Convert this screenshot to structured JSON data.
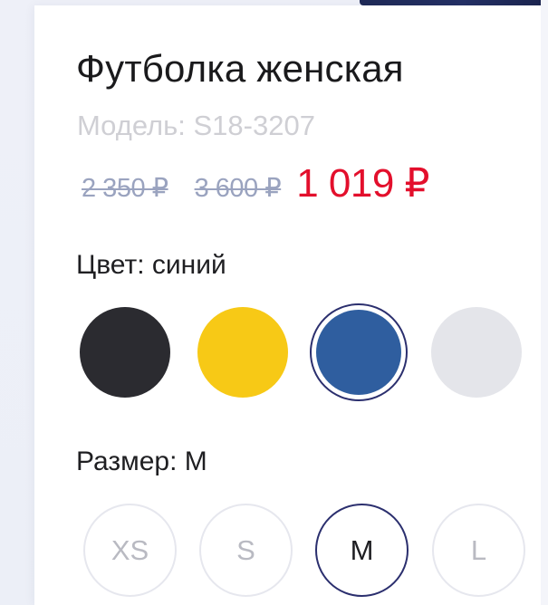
{
  "product": {
    "title": "Футболка женская",
    "model": "Модель: S18-3207"
  },
  "prices": {
    "old_1": "2 350 ₽",
    "old_2": "3 600 ₽",
    "current": "1 019 ₽"
  },
  "color_picker": {
    "label": "Цвет: синий",
    "selected": "синий",
    "options": [
      {
        "name": "black",
        "hex": "#2b2b30",
        "selected": false
      },
      {
        "name": "yellow",
        "hex": "#f7c916",
        "selected": false
      },
      {
        "name": "blue",
        "hex": "#2f5e9f",
        "selected": true
      },
      {
        "name": "light-gray",
        "hex": "#e4e5ea",
        "selected": false
      }
    ]
  },
  "size_picker": {
    "label": "Размер: M",
    "selected": "M",
    "options": [
      {
        "label": "XS",
        "selected": false
      },
      {
        "label": "S",
        "selected": false
      },
      {
        "label": "M",
        "selected": true
      },
      {
        "label": "L",
        "selected": false
      }
    ]
  },
  "colors": {
    "accent_price": "#e30f2c",
    "selection_border": "#2b2f6e",
    "muted_text": "#cfcfd4",
    "old_price": "#9aa3bf"
  }
}
